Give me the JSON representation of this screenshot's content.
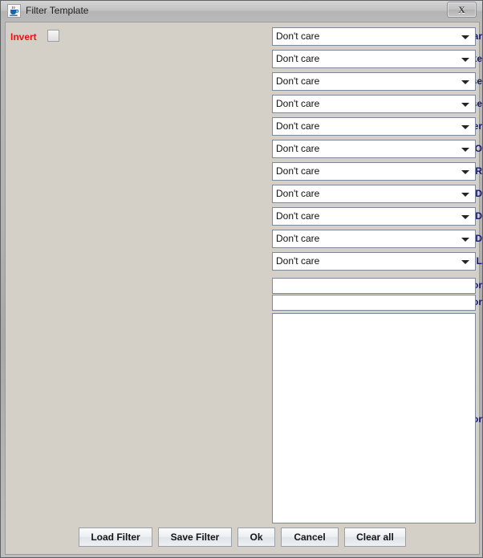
{
  "window": {
    "title": "Filter Template",
    "icon": "java-coffee-cup-icon",
    "close_label": "X"
  },
  "invert": {
    "label": "Invert",
    "checked": false
  },
  "rows": [
    {
      "label": "Year",
      "value": "Don't care",
      "type": "combobox"
    },
    {
      "label": "Strike",
      "value": "Don't care",
      "type": "combobox"
    },
    {
      "label": "Obverse",
      "value": "Don't care",
      "type": "combobox"
    },
    {
      "label": "Reverse",
      "value": "Don't care",
      "type": "combobox"
    },
    {
      "label": "Modifier",
      "value": "Don't care",
      "type": "combobox"
    },
    {
      "label": "DDO",
      "value": "Don't care",
      "type": "combobox"
    },
    {
      "label": "DDR",
      "value": "Don't care",
      "type": "combobox"
    },
    {
      "label": "RPD",
      "value": "Don't care",
      "type": "combobox"
    },
    {
      "label": "MPD",
      "value": "Don't care",
      "type": "combobox"
    },
    {
      "label": "OVD",
      "value": "Don't care",
      "type": "combobox"
    },
    {
      "label": "ML",
      "value": "Don't care",
      "type": "combobox"
    }
  ],
  "text_rows": [
    {
      "label": "Search Contributor for",
      "value": "",
      "type": "textfield"
    },
    {
      "label": "Search Attributions for",
      "value": "",
      "type": "textfield"
    }
  ],
  "comments": {
    "label": "Search Comments for",
    "value": ""
  },
  "buttons": [
    {
      "label": "Load Filter"
    },
    {
      "label": "Save Filter"
    },
    {
      "label": "Ok"
    },
    {
      "label": "Cancel"
    },
    {
      "label": "Clear all"
    }
  ],
  "colors": {
    "label_text": "#17177a",
    "invert_text": "#f01010",
    "panel_bg": "#d4d0c8",
    "field_bg": "#ffffff",
    "field_border": "#7e8a99"
  }
}
